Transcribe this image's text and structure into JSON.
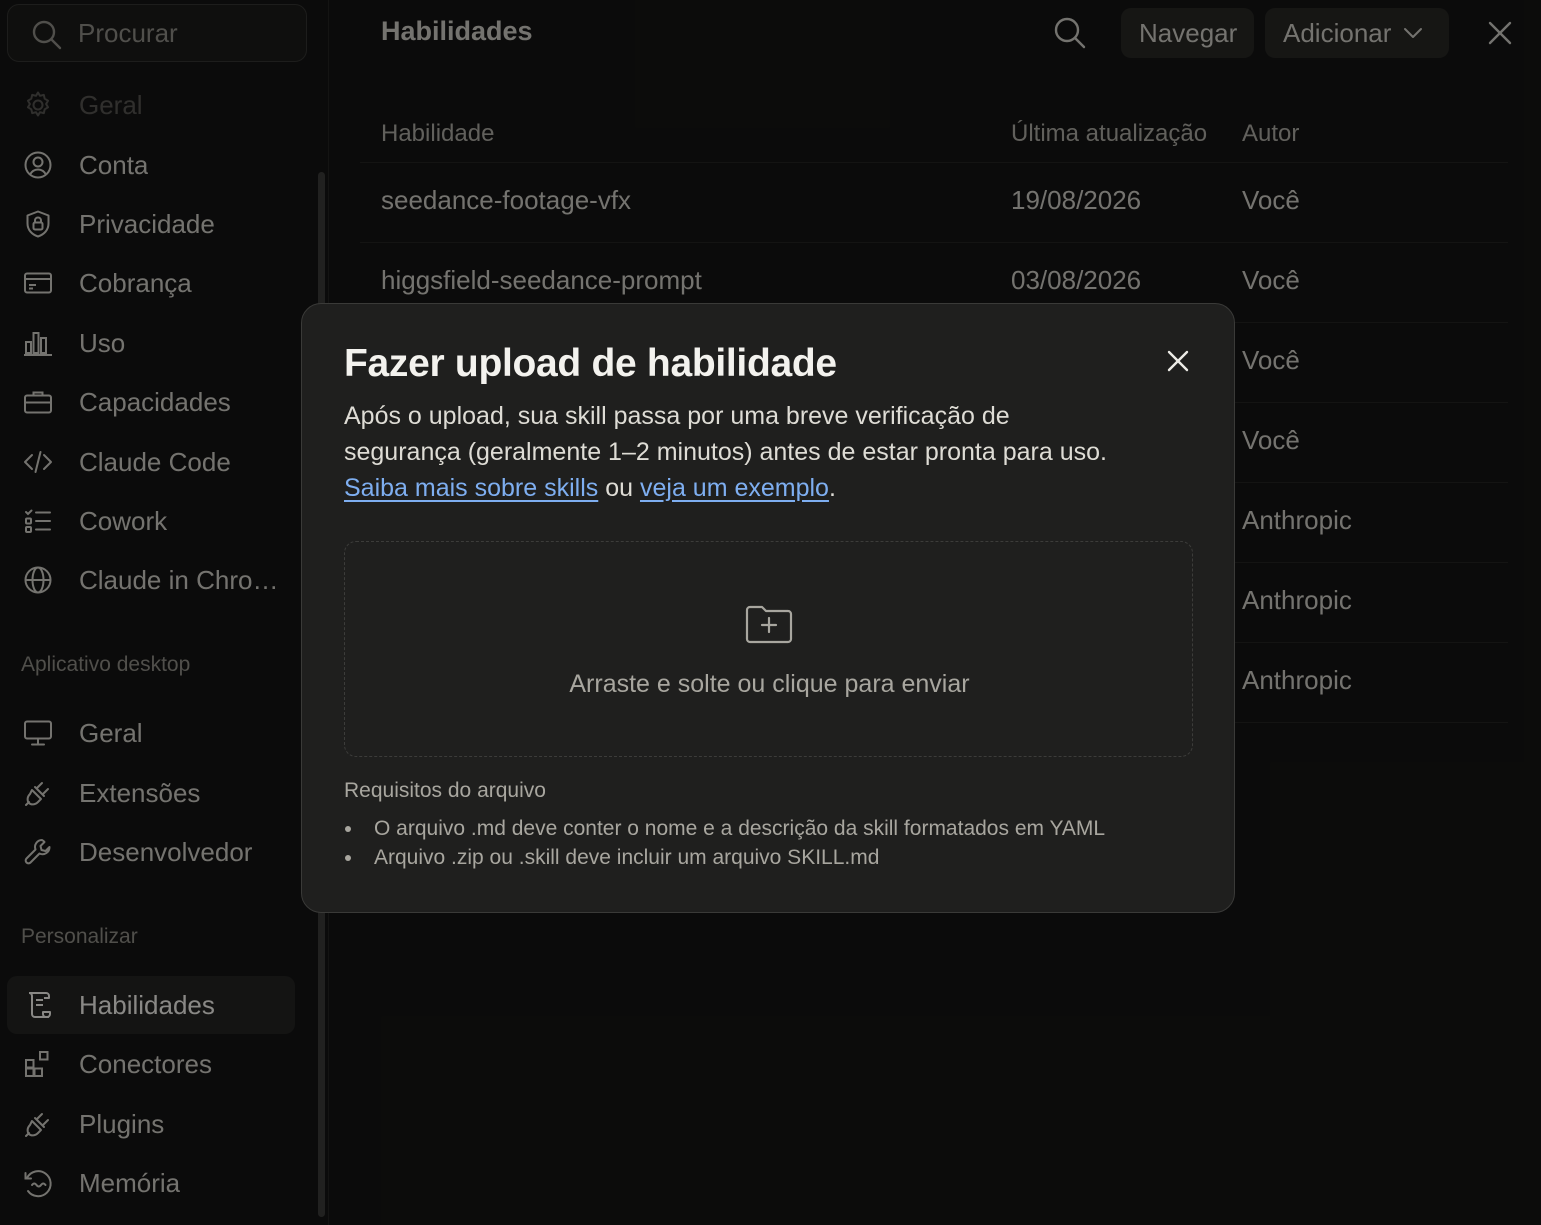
{
  "sidebar": {
    "search_placeholder": "Procurar",
    "items": [
      {
        "label": "Geral",
        "icon": "gear-icon"
      },
      {
        "label": "Conta",
        "icon": "user-circle-icon"
      },
      {
        "label": "Privacidade",
        "icon": "shield-lock-icon"
      },
      {
        "label": "Cobrança",
        "icon": "credit-card-icon"
      },
      {
        "label": "Uso",
        "icon": "bar-chart-icon"
      },
      {
        "label": "Capacidades",
        "icon": "briefcase-icon"
      },
      {
        "label": "Claude Code",
        "icon": "code-icon"
      },
      {
        "label": "Cowork",
        "icon": "checklist-icon"
      },
      {
        "label": "Claude in Chrome",
        "icon": "globe-icon"
      }
    ],
    "section_desktop": "Aplicativo desktop",
    "desktop_items": [
      {
        "label": "Geral",
        "icon": "monitor-icon"
      },
      {
        "label": "Extensões",
        "icon": "plug-icon"
      },
      {
        "label": "Desenvolvedor",
        "icon": "wrench-icon"
      }
    ],
    "section_customize": "Personalizar",
    "customize_items": [
      {
        "label": "Habilidades",
        "icon": "scroll-icon"
      },
      {
        "label": "Conectores",
        "icon": "grid-plus-icon"
      },
      {
        "label": "Plugins",
        "icon": "plug-icon"
      },
      {
        "label": "Memória",
        "icon": "memory-icon"
      }
    ]
  },
  "header": {
    "title": "Habilidades",
    "browse_label": "Navegar",
    "add_label": "Adicionar"
  },
  "table": {
    "columns": [
      "Habilidade",
      "Última atualização",
      "Autor"
    ],
    "rows": [
      {
        "name": "seedance-footage-vfx",
        "date": "19/08/2026",
        "author": "Você"
      },
      {
        "name": "higgsfield-seedance-prompt",
        "date": "03/08/2026",
        "author": "Você"
      },
      {
        "name": "",
        "date": "",
        "author": "Você"
      },
      {
        "name": "",
        "date": "",
        "author": "Você"
      },
      {
        "name": "",
        "date": "",
        "author": "Anthropic"
      },
      {
        "name": "",
        "date": "",
        "author": "Anthropic"
      },
      {
        "name": "",
        "date": "",
        "author": "Anthropic"
      }
    ]
  },
  "modal": {
    "title": "Fazer upload de habilidade",
    "desc_text": "Após o upload, sua skill passa por uma breve verificação de segurança (geralmente 1–2 minutos) antes de estar pronta para uso.",
    "link_learn": "Saiba mais sobre skills",
    "desc_or": "ou",
    "link_example": "veja um exemplo",
    "desc_end": ".",
    "dropzone_text": "Arraste e solte ou clique para enviar",
    "requirements_title": "Requisitos do arquivo",
    "requirements": [
      "O arquivo .md deve conter o nome e a descrição da skill formatados em YAML",
      "Arquivo .zip ou .skill deve incluir um arquivo SKILL.md"
    ]
  },
  "colors": {
    "background": "#141413",
    "modal": "#1f1f1e",
    "link": "#7eaef0",
    "active_item": "#242422"
  }
}
